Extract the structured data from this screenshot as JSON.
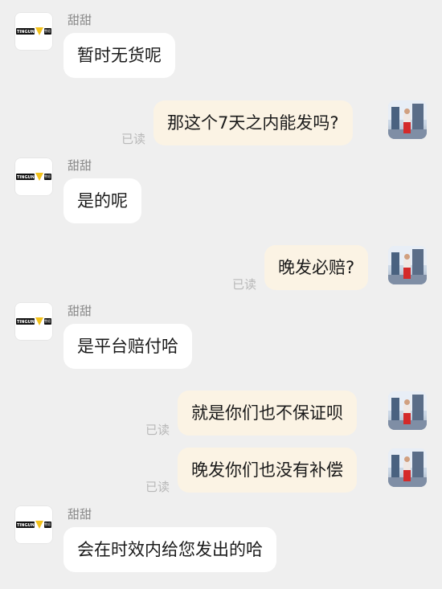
{
  "chat": {
    "messages": [
      {
        "sender": "甜甜",
        "text": "暂时无货呢"
      },
      {
        "text": "那这个7天之内能发吗?",
        "status": "已读"
      },
      {
        "sender": "甜甜",
        "text": "是的呢"
      },
      {
        "text": "晚发必赔?",
        "status": "已读"
      },
      {
        "sender": "甜甜",
        "text": "是平台赔付哈"
      },
      {
        "text": "就是你们也不保证呗",
        "status": "已读"
      },
      {
        "text": "晚发你们也没有补偿",
        "status": "已读"
      },
      {
        "sender": "甜甜",
        "text": "会在时效内给您发出的哈"
      }
    ]
  },
  "logo": {
    "brand_text": "TINGUN",
    "badge_text": "雪貂"
  },
  "colors": {
    "background": "#efefef",
    "left_bubble": "#ffffff",
    "right_bubble": "#fbf3e4",
    "read_status": "#b8b8b8",
    "logo_accent": "#f3c21b"
  },
  "icons": {
    "left_avatar": "brand-logo-icon",
    "right_avatar": "user-photo-avatar"
  }
}
